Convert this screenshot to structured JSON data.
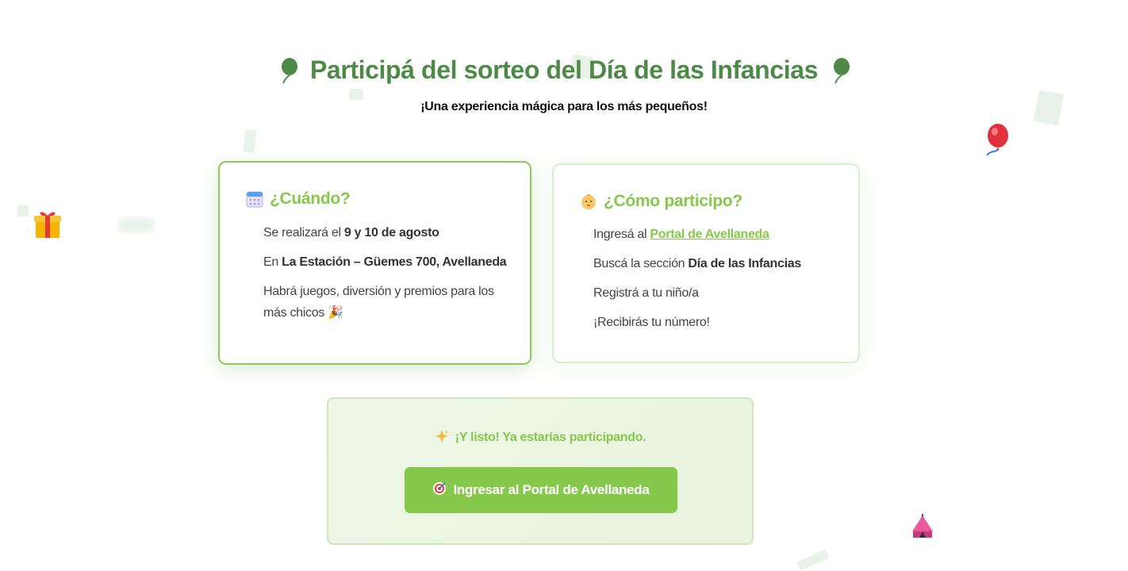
{
  "header": {
    "title": "Participá del sorteo del Día de las Infancias",
    "subtitle": "¡Una experiencia mágica para los más pequeños!"
  },
  "when_card": {
    "heading": "¿Cuándo?",
    "icon": "calendar-icon",
    "items": [
      {
        "prefix": "Se realizará el ",
        "bold": "9 y 10 de agosto",
        "suffix": ""
      },
      {
        "prefix": "En ",
        "bold": "La Estación – Güemes 700, Avellaneda",
        "suffix": ""
      },
      {
        "prefix": "Habrá juegos, diversión y premios para los más chicos ",
        "bold": "",
        "suffix": "🎉"
      }
    ]
  },
  "how_card": {
    "heading": "¿Cómo participo?",
    "icon": "baby-icon",
    "step1_prefix": "Ingresá al ",
    "step1_link": "Portal de Avellaneda",
    "step2_prefix": "Buscá la sección ",
    "step2_bold": "Día de las Infancias",
    "step3": "Registrá a tu niño/a",
    "step4": "¡Recibirás tu número!"
  },
  "final": {
    "message": "¡Y listo! Ya estarías participando.",
    "icon": "sparkles-icon",
    "button_label": "Ingresar al Portal de Avellaneda",
    "button_icon": "target-icon"
  },
  "decorations": [
    "balloon-icon",
    "gift-icon",
    "circus-tent-icon"
  ],
  "colors": {
    "title": "#4e8a47",
    "accent": "#86c84c",
    "border": "#8cc95a"
  }
}
